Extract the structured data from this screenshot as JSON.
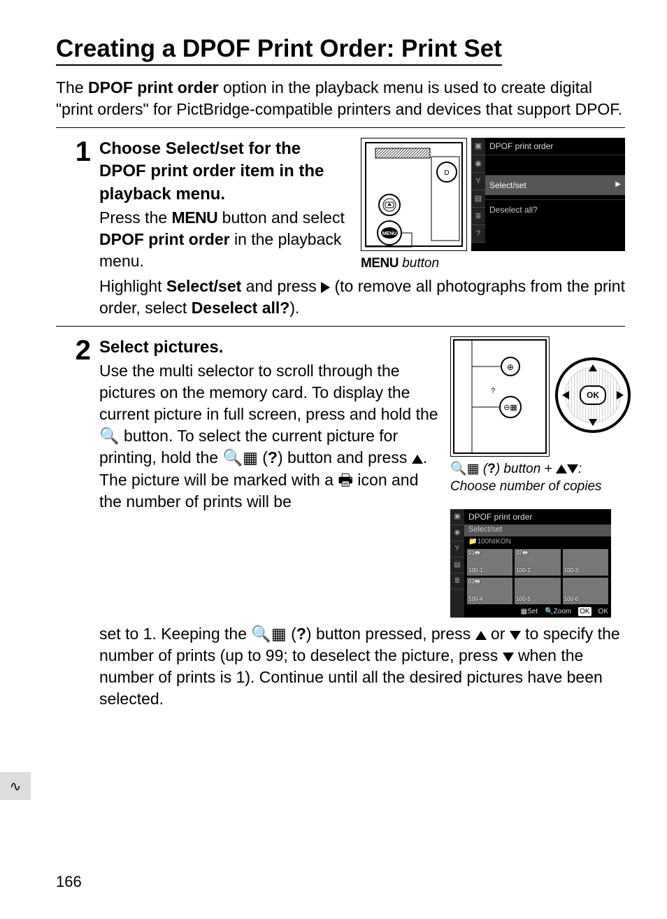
{
  "title": "Creating a DPOF Print Order: Print Set",
  "intro": {
    "pre": "The ",
    "bold": "DPOF print order",
    "post": " option in the playback menu is used to create digital \"print orders\" for PictBridge-compatible printers and devices that support DPOF."
  },
  "step1": {
    "num": "1",
    "h_a": "Choose ",
    "h_b": "Select/set",
    "h_c": " for the ",
    "h_d": "DPOF print order",
    "h_e": " item in the playback menu.",
    "p1a": "Press the ",
    "p1menu": "MENU",
    "p1b": " button and select ",
    "p1bold": "DPOF print order",
    "p1c": " in the playback menu.",
    "p2a": "Highlight ",
    "p2bold1": "Select/set",
    "p2b": " and press ",
    "p2c": " (to remove all photographs from the print order, select ",
    "p2bold2": "Deselect all?",
    "p2d": ").",
    "caption_menu": "MENU",
    "caption_rest": " button",
    "menu": {
      "title": "DPOF print order",
      "item1": "Select/set",
      "item2": "Deselect all?"
    }
  },
  "step2": {
    "num": "2",
    "head": "Select pictures.",
    "p_a": "Use the multi selector to scroll through the pictures on the memory card. To display the current picture in full screen, press and hold the ",
    "p_b": " button. To select the current picture for printing, hold the ",
    "p_c": " (",
    "p_q1": "?",
    "p_d": ") button and press ",
    "p_e": ". The picture will be marked with a ",
    "p_f": " icon and the number of prints will be",
    "cont_a": "set to 1. Keeping the ",
    "cont_b": " (",
    "cont_q": "?",
    "cont_c": ") button pressed, press ",
    "cont_d": " or ",
    "cont_e": " to specify the number of prints (up to 99; to deselect the picture, press ",
    "cont_f": " when the number of prints is 1). Continue until all the desired pictures have been selected.",
    "caption2_a": " (",
    "caption2_q": "?",
    "caption2_b": ") button + ",
    "caption2_c": ": Choose number of copies",
    "ok": "OK",
    "thumb": {
      "title": "DPOF print order",
      "sub": "Select/set",
      "folder": "📁100NIKON",
      "cells": [
        {
          "num": "01",
          "id": "100-1",
          "mark": true
        },
        {
          "num": "07",
          "id": "100-2",
          "mark": true
        },
        {
          "num": "",
          "id": "100-3",
          "mark": false
        },
        {
          "num": "02",
          "id": "100-4",
          "mark": true
        },
        {
          "num": "",
          "id": "100-5",
          "mark": false
        },
        {
          "num": "",
          "id": "100-6",
          "mark": false
        }
      ],
      "footer_set": "Set",
      "footer_zoom": "Zoom",
      "footer_ok": "OK"
    }
  },
  "page_number": "166"
}
